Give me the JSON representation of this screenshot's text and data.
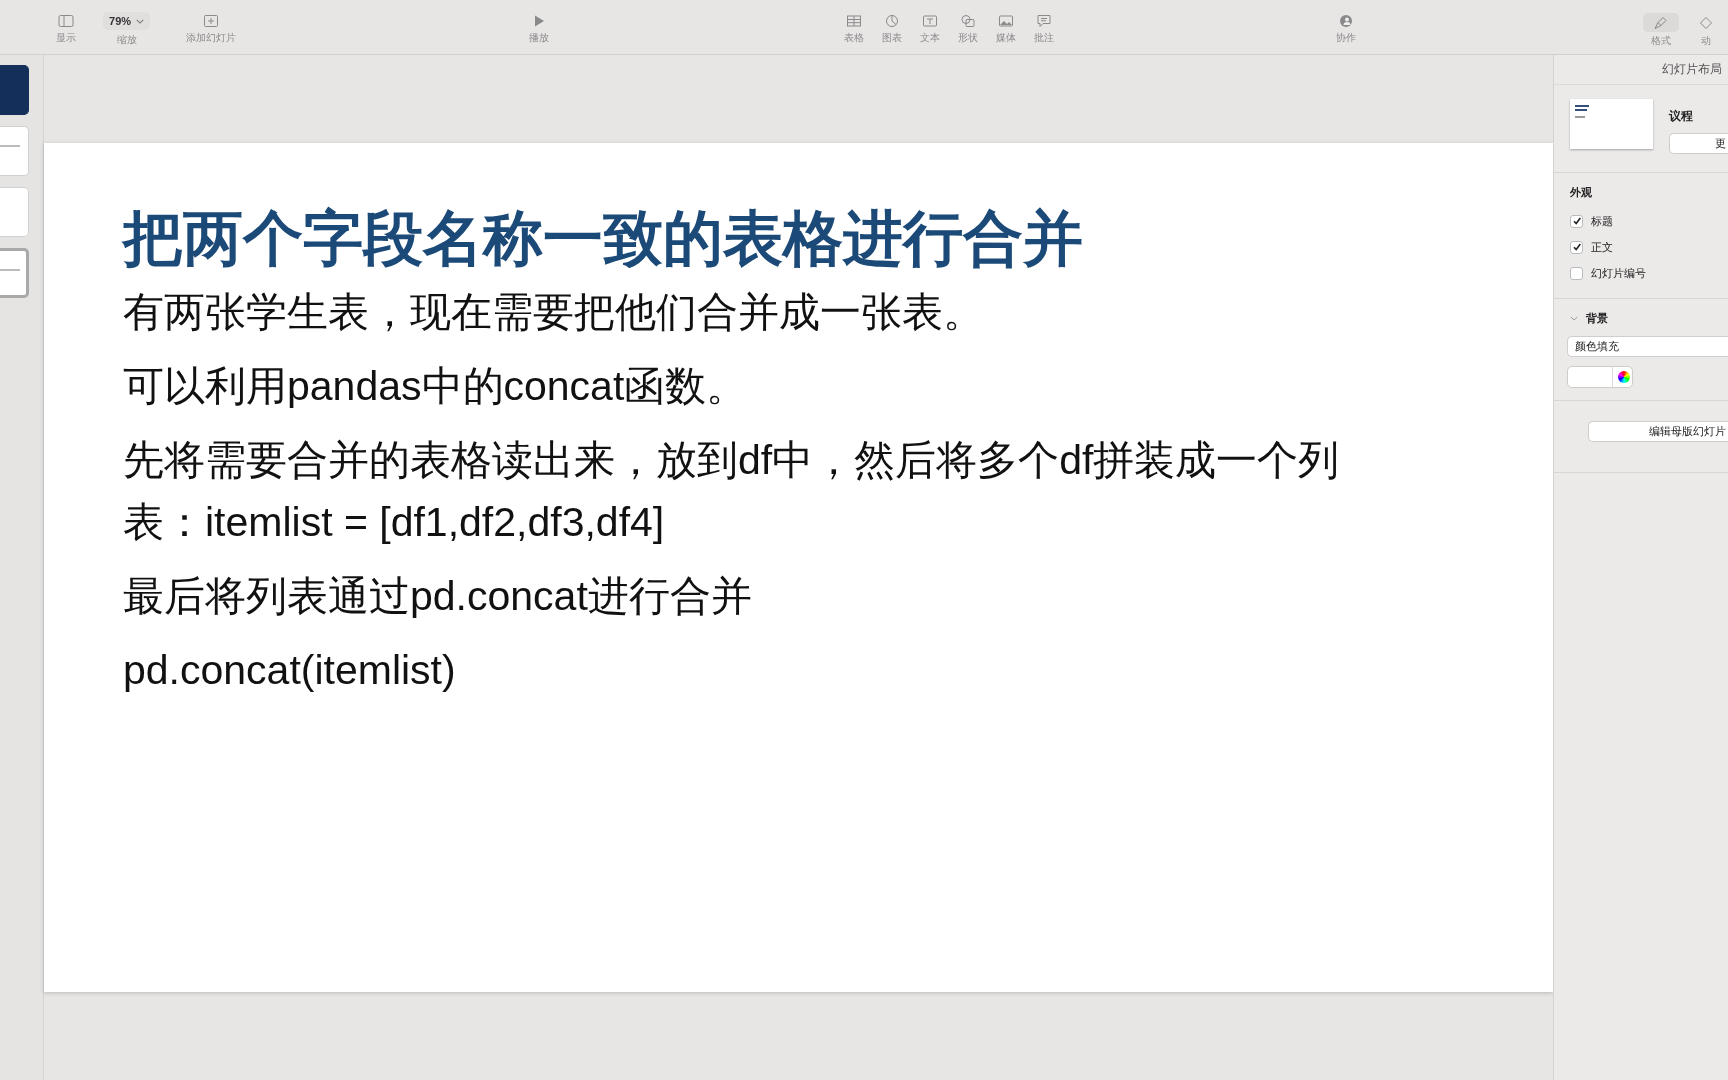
{
  "toolbar": {
    "left": [
      {
        "label": "显示",
        "kind": "sidebar"
      },
      {
        "label": "缩放",
        "kind": "zoom",
        "value": "79%"
      },
      {
        "label": "添加幻灯片",
        "kind": "add"
      }
    ],
    "play": {
      "label": "播放",
      "kind": "play"
    },
    "insert": [
      {
        "label": "表格",
        "kind": "table"
      },
      {
        "label": "图表",
        "kind": "chart"
      },
      {
        "label": "文本",
        "kind": "text"
      },
      {
        "label": "形状",
        "kind": "shape"
      },
      {
        "label": "媒体",
        "kind": "media"
      },
      {
        "label": "批注",
        "kind": "comment"
      }
    ],
    "collab": {
      "label": "协作",
      "kind": "collab"
    },
    "right": [
      {
        "label": "格式",
        "kind": "format",
        "selected": true
      },
      {
        "label": "动",
        "kind": "animate",
        "selected": false
      }
    ]
  },
  "navigator": {
    "slides": [
      {
        "kind": "dark",
        "selected": false
      },
      {
        "kind": "light",
        "selected": false
      },
      {
        "kind": "blank",
        "selected": false
      },
      {
        "kind": "light",
        "selected": true
      }
    ]
  },
  "slide": {
    "title": "把两个字段名称一致的表格进行合并",
    "paragraphs": [
      "有两张学生表，现在需要把他们合并成一张表。",
      "可以利用pandas中的concat函数。",
      "先将需要合并的表格读出来，放到df中，然后将多个df拼装成一个列表：itemlist = [df1,df2,df3,df4]",
      "最后将列表通过pd.concat进行合并",
      "pd.concat(itemlist)"
    ]
  },
  "inspector": {
    "title": "幻灯片布局",
    "layout": {
      "name": "议程",
      "button": "更"
    },
    "appearance": {
      "heading": "外观",
      "options": [
        {
          "label": "标题",
          "checked": true
        },
        {
          "label": "正文",
          "checked": true
        },
        {
          "label": "幻灯片编号",
          "checked": false
        }
      ]
    },
    "background": {
      "heading": "背景",
      "expanded": true,
      "fill": "颜色填充"
    },
    "master_button": "编辑母版幻灯片"
  }
}
